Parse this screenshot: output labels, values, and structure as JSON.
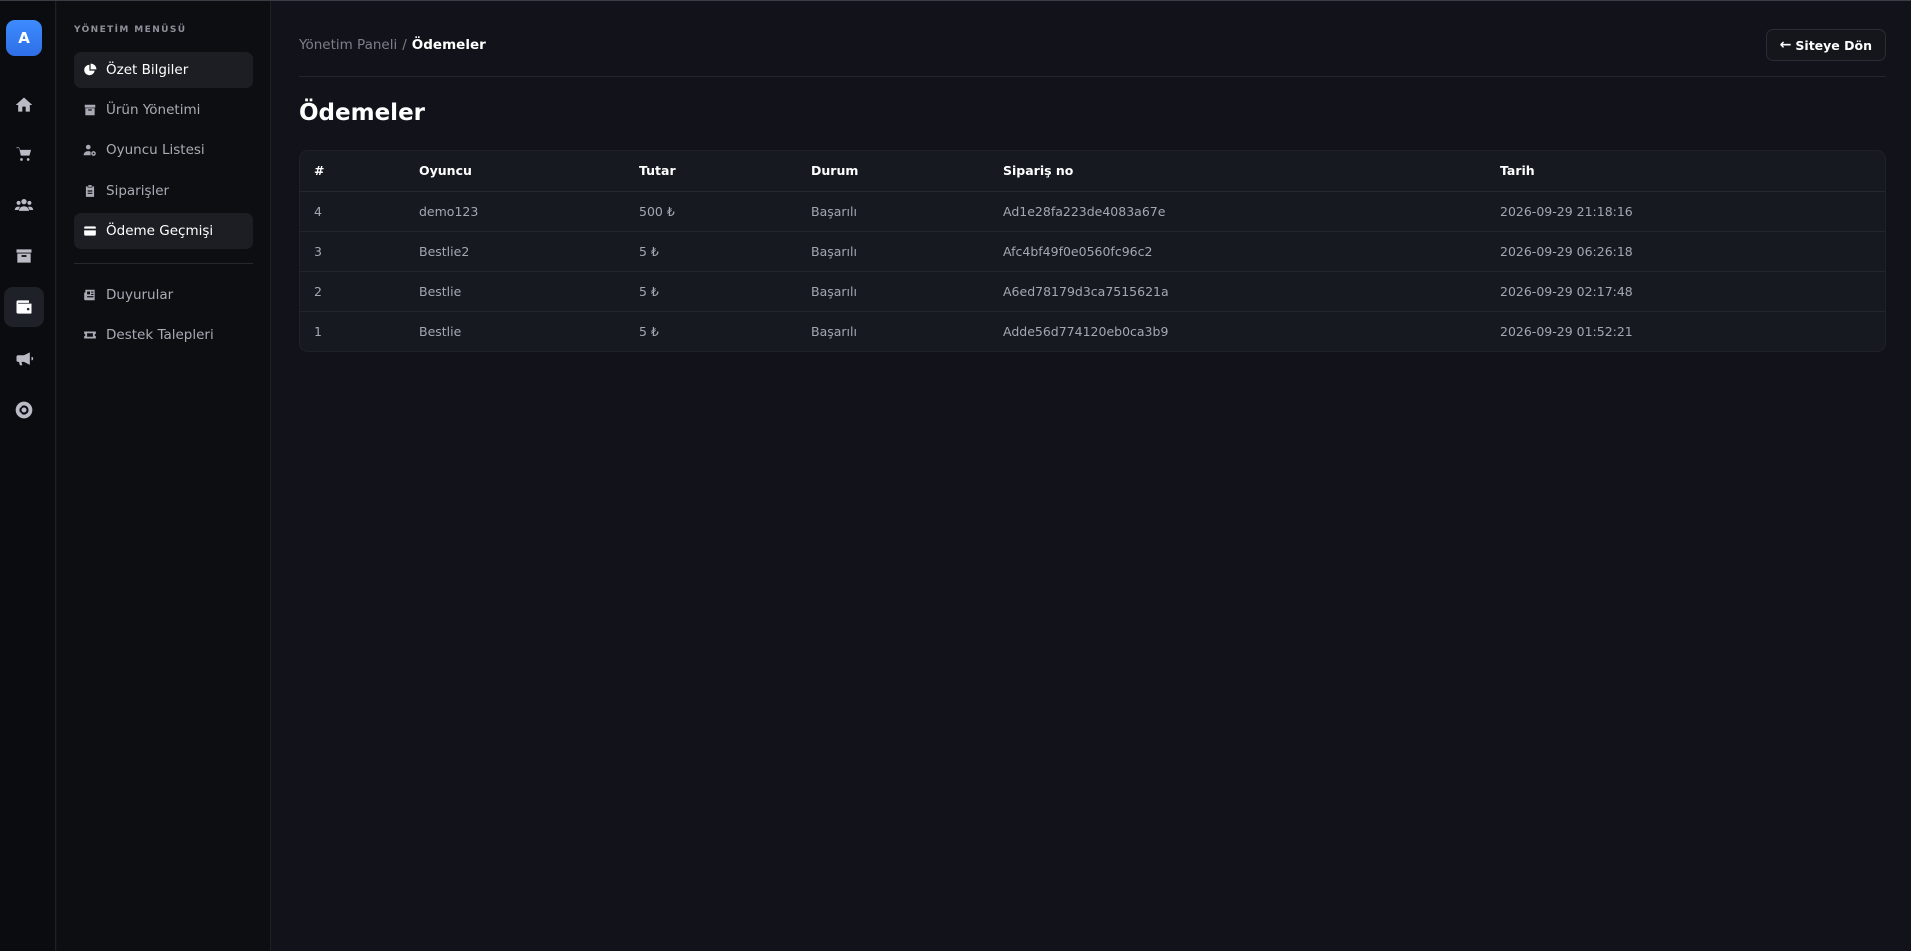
{
  "logo": {
    "letter": "A"
  },
  "rail_items": [
    {
      "name": "home-icon",
      "active": false
    },
    {
      "name": "cart-icon",
      "active": false
    },
    {
      "name": "users-icon",
      "active": false
    },
    {
      "name": "archive-icon",
      "active": false
    },
    {
      "name": "wallet-icon",
      "active": true
    },
    {
      "name": "megaphone-icon",
      "active": false
    },
    {
      "name": "lifebuoy-icon",
      "active": false
    }
  ],
  "sidebar": {
    "heading": "YÖNETİM MENÜSÜ",
    "items": [
      {
        "label": "Özet Bilgiler",
        "icon": "pie-chart-icon",
        "active": true
      },
      {
        "label": "Ürün Yönetimi",
        "icon": "box-icon",
        "active": false
      },
      {
        "label": "Oyuncu Listesi",
        "icon": "user-gear-icon",
        "active": false
      },
      {
        "label": "Siparişler",
        "icon": "clipboard-icon",
        "active": false
      },
      {
        "label": "Ödeme Geçmişi",
        "icon": "credit-card-icon",
        "active": true
      },
      {
        "label": "Duyurular",
        "icon": "newspaper-icon",
        "active": false
      },
      {
        "label": "Destek Talepleri",
        "icon": "ticket-icon",
        "active": false
      }
    ]
  },
  "breadcrumb": {
    "parent": "Yönetim Paneli",
    "separator": "/",
    "current": "Ödemeler"
  },
  "back_button": {
    "label": "Siteye Dön",
    "icon": "arrow-left-icon"
  },
  "page_title": "Ödemeler",
  "table": {
    "headers": [
      "#",
      "Oyuncu",
      "Tutar",
      "Durum",
      "Sipariş no",
      "Tarih"
    ],
    "rows": [
      [
        "4",
        "demo123",
        "500 ₺",
        "Başarılı",
        "Ad1e28fa223de4083a67e",
        "2026-09-29 21:18:16"
      ],
      [
        "3",
        "Bestlie2",
        "5 ₺",
        "Başarılı",
        "Afc4bf49f0e0560fc96c2",
        "2026-09-29 06:26:18"
      ],
      [
        "2",
        "Bestlie",
        "5 ₺",
        "Başarılı",
        "A6ed78179d3ca7515621a",
        "2026-09-29 02:17:48"
      ],
      [
        "1",
        "Bestlie",
        "5 ₺",
        "Başarılı",
        "Adde56d774120eb0ca3b9",
        "2026-09-29 01:52:21"
      ]
    ]
  },
  "colors": {
    "background": "#12131a",
    "sidebar": "#0d0e12",
    "accent": "#3d8bff",
    "table_bg": "#171920"
  }
}
